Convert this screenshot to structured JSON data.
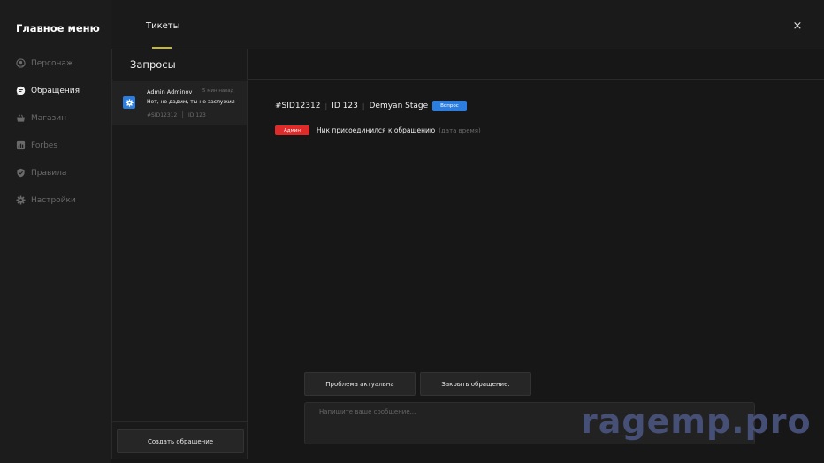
{
  "sidebar": {
    "title": "Главное меню",
    "items": [
      {
        "label": "Персонаж",
        "icon": "user-circle-icon",
        "active": false
      },
      {
        "label": "Обращения",
        "icon": "chat-icon",
        "active": true
      },
      {
        "label": "Магазин",
        "icon": "shopping-basket-icon",
        "active": false
      },
      {
        "label": "Forbes",
        "icon": "chart-icon",
        "active": false
      },
      {
        "label": "Правила",
        "icon": "shield-check-icon",
        "active": false
      },
      {
        "label": "Настройки",
        "icon": "gear-icon",
        "active": false
      }
    ]
  },
  "topbar": {
    "tab_label": "Тикеты",
    "close_label": "×"
  },
  "requests": {
    "title": "Запросы",
    "tickets": [
      {
        "author": "Admin Adminov",
        "time": "5 мин назад",
        "message": "Нет, не дадим, ты не заслужил",
        "id": "#SID12312",
        "user_id": "ID 123"
      }
    ],
    "create_label": "Создать обращение"
  },
  "ticket": {
    "sid": "#SID12312",
    "user_id": "ID 123",
    "name": "Demyan Stage",
    "category": "Вопрос",
    "log": [
      {
        "role": "Админ",
        "text": "Ник присоединился к обращению",
        "time": "(дата время)"
      }
    ]
  },
  "actions": {
    "actual_label": "Проблема актуальна",
    "close_label": "Закрыть обращение."
  },
  "composer": {
    "placeholder": "Напишите ваше сообщение..."
  },
  "watermark": "ragemp.pro",
  "colors": {
    "accent_blue": "#2b7de0",
    "admin_red": "#e02b2b",
    "tab_underline": "#c6b92a",
    "background": "#171717"
  }
}
